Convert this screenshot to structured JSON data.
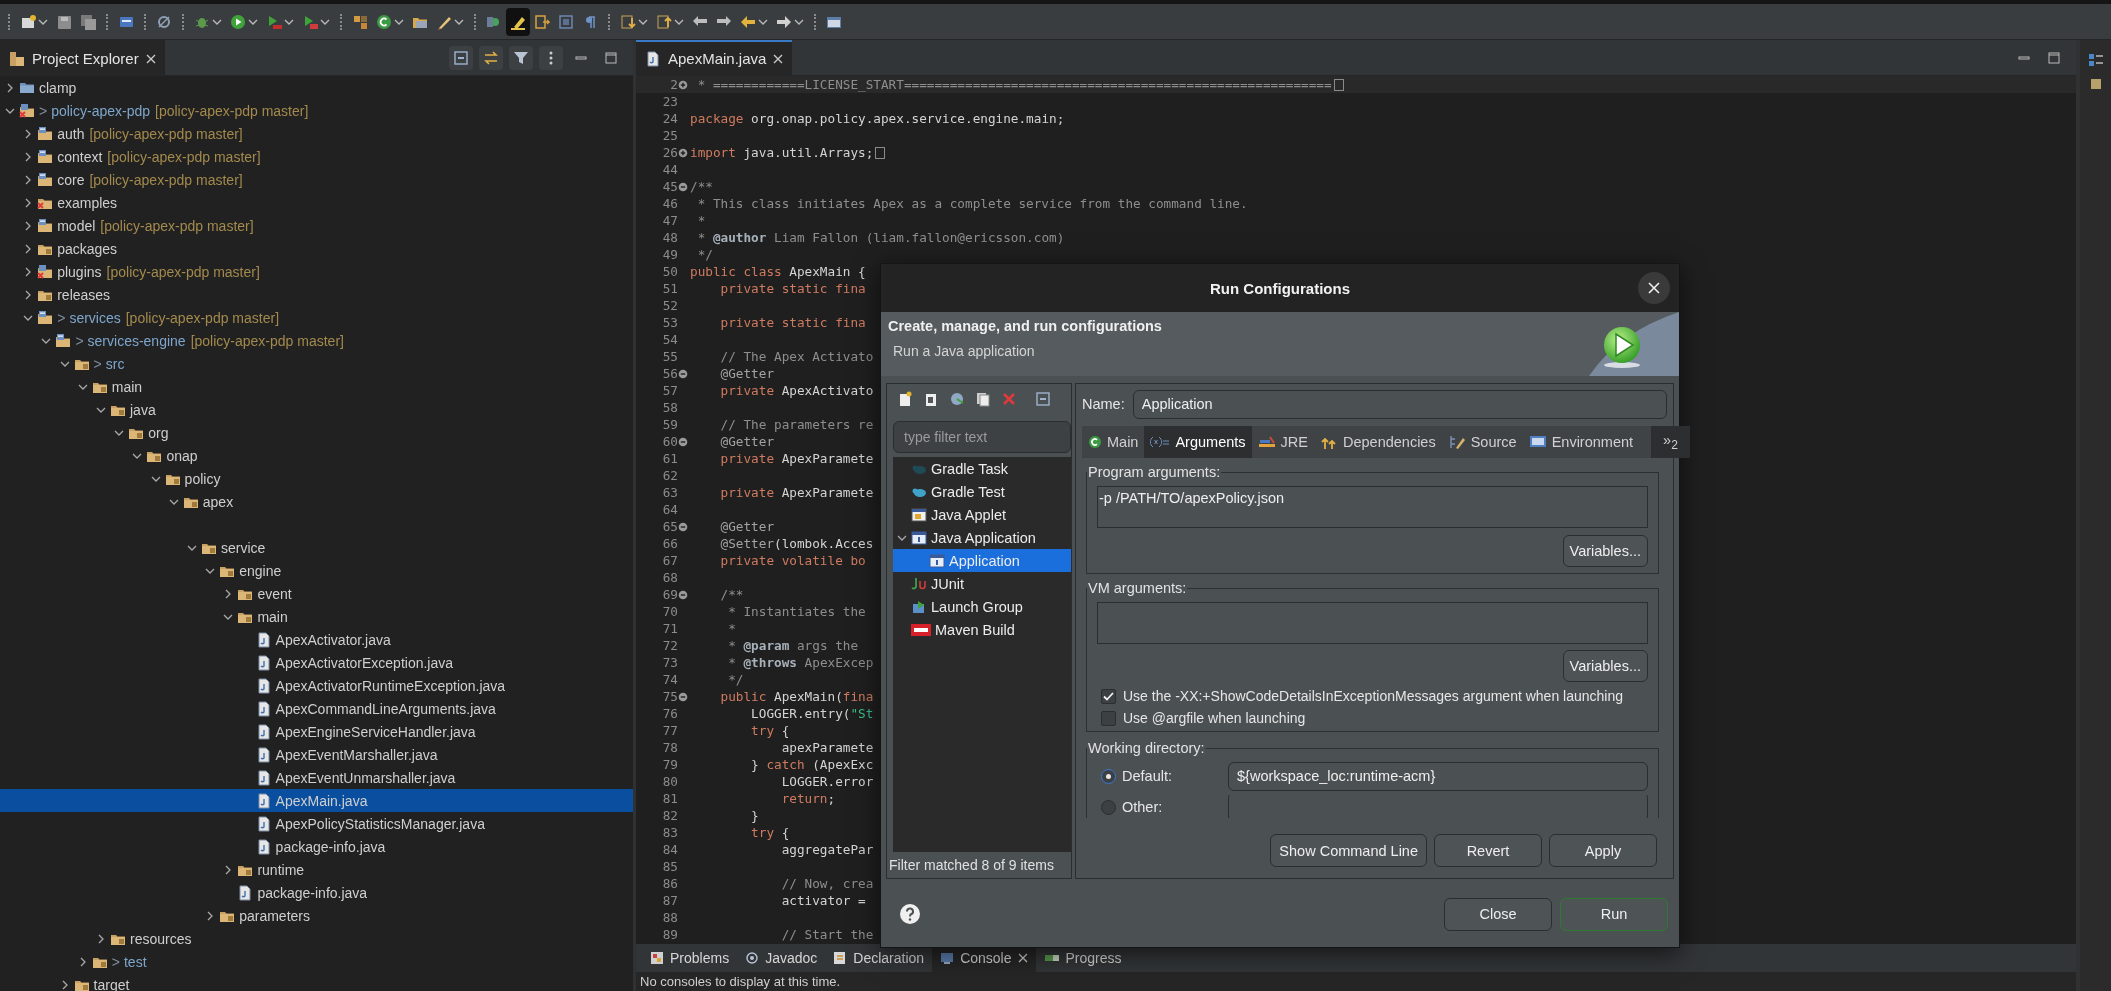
{
  "toolbar": {
    "toggle_on": true
  },
  "explorer": {
    "title": "Project Explorer",
    "tree": [
      {
        "name": "clamp",
        "kind": "closed-project",
        "expanded": false,
        "selected": false
      },
      {
        "marker": ">",
        "name": "policy-apex-pdp",
        "repo": "[policy-apex-pdp master]",
        "kind": "error-project",
        "expanded": true,
        "selected": false,
        "children": [
          {
            "name": "auth",
            "repo": "[policy-apex-pdp master]",
            "kind": "maven-project",
            "expanded": false,
            "selected": false
          },
          {
            "name": "context",
            "repo": "[policy-apex-pdp master]",
            "kind": "maven-project",
            "expanded": false,
            "selected": false
          },
          {
            "name": "core",
            "repo": "[policy-apex-pdp master]",
            "kind": "maven-project",
            "expanded": false,
            "selected": false
          },
          {
            "name": "examples",
            "kind": "error-folder",
            "expanded": false,
            "selected": false
          },
          {
            "name": "model",
            "repo": "[policy-apex-pdp master]",
            "kind": "maven-project",
            "expanded": false,
            "selected": false
          },
          {
            "name": "packages",
            "kind": "package-folder",
            "expanded": false,
            "selected": false
          },
          {
            "name": "plugins",
            "repo": "[policy-apex-pdp master]",
            "kind": "error-project",
            "expanded": false,
            "selected": false
          },
          {
            "name": "releases",
            "kind": "package-folder",
            "expanded": false,
            "selected": false
          },
          {
            "marker": ">",
            "name": "services",
            "repo": "[policy-apex-pdp master]",
            "kind": "maven-project",
            "expanded": true,
            "selected": false,
            "children": [
              {
                "marker": ">",
                "name": "services-engine",
                "repo": "[policy-apex-pdp master]",
                "kind": "maven-project",
                "expanded": true,
                "selected": false,
                "children": [
                  {
                    "marker": ">",
                    "name": "src",
                    "kind": "package-folder",
                    "expanded": true,
                    "selected": false,
                    "children": [
                      {
                        "name": "main",
                        "kind": "package-folder",
                        "expanded": true,
                        "selected": false,
                        "children": [
                          {
                            "name": "java",
                            "kind": "package-folder",
                            "expanded": true,
                            "selected": false,
                            "children": [
                              {
                                "name": "org",
                                "kind": "package-folder",
                                "expanded": true,
                                "selected": false,
                                "children": [
                                  {
                                    "name": "onap",
                                    "kind": "package-folder",
                                    "expanded": true,
                                    "selected": false,
                                    "children": [
                                      {
                                        "name": "policy",
                                        "kind": "package-folder",
                                        "expanded": true,
                                        "selected": false,
                                        "children": [
                                          {
                                            "name": "apex",
                                            "kind": "package-folder",
                                            "expanded": true,
                                            "selected": false,
                                            "children": [
                                              {
                                                "name": "service",
                                                "kind": "package-folder",
                                                "expanded": true,
                                                "selected": false,
                                                "gap_before": true,
                                                "children": [
                                                  {
                                                    "name": "engine",
                                                    "kind": "package-folder",
                                                    "expanded": true,
                                                    "selected": false,
                                                    "children": [
                                                      {
                                                        "name": "event",
                                                        "kind": "package-folder",
                                                        "expanded": false,
                                                        "selected": false
                                                      },
                                                      {
                                                        "name": "main",
                                                        "kind": "package-folder",
                                                        "expanded": true,
                                                        "selected": false,
                                                        "children": [
                                                          {
                                                            "name": "ApexActivator.java",
                                                            "kind": "java-file",
                                                            "selected": false
                                                          },
                                                          {
                                                            "name": "ApexActivatorException.java",
                                                            "kind": "java-file",
                                                            "selected": false
                                                          },
                                                          {
                                                            "name": "ApexActivatorRuntimeException.java",
                                                            "kind": "java-file",
                                                            "selected": false
                                                          },
                                                          {
                                                            "name": "ApexCommandLineArguments.java",
                                                            "kind": "java-file",
                                                            "selected": false
                                                          },
                                                          {
                                                            "name": "ApexEngineServiceHandler.java",
                                                            "kind": "java-file",
                                                            "selected": false
                                                          },
                                                          {
                                                            "name": "ApexEventMarshaller.java",
                                                            "kind": "java-file",
                                                            "selected": false
                                                          },
                                                          {
                                                            "name": "ApexEventUnmarshaller.java",
                                                            "kind": "java-file",
                                                            "selected": false
                                                          },
                                                          {
                                                            "name": "ApexMain.java",
                                                            "kind": "java-file",
                                                            "selected": true
                                                          },
                                                          {
                                                            "name": "ApexPolicyStatisticsManager.java",
                                                            "kind": "java-file",
                                                            "selected": false
                                                          },
                                                          {
                                                            "name": "package-info.java",
                                                            "kind": "java-file",
                                                            "selected": false
                                                          }
                                                        ]
                                                      },
                                                      {
                                                        "name": "runtime",
                                                        "kind": "package-folder",
                                                        "expanded": false,
                                                        "selected": false
                                                      },
                                                      {
                                                        "name": "package-info.java",
                                                        "kind": "java-file",
                                                        "selected": false
                                                      }
                                                    ]
                                                  },
                                                  {
                                                    "name": "parameters",
                                                    "kind": "package-folder",
                                                    "expanded": false,
                                                    "selected": false
                                                  }
                                                ]
                                              }
                                            ]
                                          }
                                        ]
                                      }
                                    ]
                                  }
                                ]
                              }
                            ]
                          },
                          {
                            "name": "resources",
                            "kind": "package-folder",
                            "expanded": false,
                            "selected": false
                          }
                        ]
                      },
                      {
                        "marker": ">",
                        "name": "test",
                        "kind": "package-folder",
                        "expanded": false,
                        "selected": false
                      }
                    ]
                  },
                  {
                    "name": "target",
                    "kind": "package-folder",
                    "expanded": false,
                    "selected": false
                  }
                ]
              }
            ]
          }
        ]
      }
    ]
  },
  "editor": {
    "tab": "ApexMain.java",
    "lines": [
      {
        "n": "2",
        "collapsed": true,
        "current": true,
        "segs": [
          {
            "kind": "comment",
            "text": " * ============LICENSE_START========================================================"
          }
        ]
      },
      {
        "n": "23"
      },
      {
        "n": "24",
        "segs": [
          {
            "kind": "keyword",
            "text": "package"
          },
          {
            "kind": "plain",
            "text": " org.onap.policy.apex.service.engine.main;"
          }
        ]
      },
      {
        "n": "25"
      },
      {
        "n": "26",
        "collapsed": true,
        "segs": [
          {
            "kind": "keyword",
            "text": "import"
          },
          {
            "kind": "plain",
            "text": " java.util.Arrays;"
          }
        ]
      },
      {
        "n": "44"
      },
      {
        "n": "45",
        "collapsed": false,
        "segs": [
          {
            "kind": "comment",
            "text": "/**"
          }
        ]
      },
      {
        "n": "46",
        "segs": [
          {
            "kind": "comment",
            "text": " * This class initiates Apex as a complete service from the command line."
          }
        ]
      },
      {
        "n": "47",
        "segs": [
          {
            "kind": "comment",
            "text": " *"
          }
        ]
      },
      {
        "n": "48",
        "segs": [
          {
            "kind": "comment",
            "text": " * "
          },
          {
            "kind": "doctag",
            "text": "@author"
          },
          {
            "kind": "comment",
            "text": " Liam Fallon (liam.fallon@ericsson.com)"
          }
        ]
      },
      {
        "n": "49",
        "segs": [
          {
            "kind": "comment",
            "text": " */"
          }
        ]
      },
      {
        "n": "50",
        "segs": [
          {
            "kind": "keyword",
            "text": "public class"
          },
          {
            "kind": "plain",
            "text": " ApexMain {"
          }
        ]
      },
      {
        "n": "51",
        "segs": [
          {
            "kind": "keyword",
            "text": "    private static fina"
          }
        ]
      },
      {
        "n": "52"
      },
      {
        "n": "53",
        "segs": [
          {
            "kind": "keyword",
            "text": "    private static fina"
          }
        ]
      },
      {
        "n": "54"
      },
      {
        "n": "55",
        "segs": [
          {
            "kind": "comment",
            "text": "    // The Apex Activato"
          }
        ]
      },
      {
        "n": "56",
        "collapsed": false,
        "segs": [
          {
            "kind": "annotation",
            "text": "    @Getter"
          }
        ]
      },
      {
        "n": "57",
        "segs": [
          {
            "kind": "keyword",
            "text": "    private"
          },
          {
            "kind": "plain",
            "text": " ApexActivato"
          }
        ]
      },
      {
        "n": "58"
      },
      {
        "n": "59",
        "segs": [
          {
            "kind": "comment",
            "text": "    // The parameters re"
          }
        ]
      },
      {
        "n": "60",
        "collapsed": false,
        "segs": [
          {
            "kind": "annotation",
            "text": "    @Getter"
          }
        ]
      },
      {
        "n": "61",
        "segs": [
          {
            "kind": "keyword",
            "text": "    private"
          },
          {
            "kind": "plain",
            "text": " ApexParamete"
          }
        ]
      },
      {
        "n": "62"
      },
      {
        "n": "63",
        "segs": [
          {
            "kind": "keyword",
            "text": "    private"
          },
          {
            "kind": "plain",
            "text": " ApexParamete"
          }
        ]
      },
      {
        "n": "64"
      },
      {
        "n": "65",
        "collapsed": false,
        "segs": [
          {
            "kind": "annotation",
            "text": "    @Getter"
          }
        ]
      },
      {
        "n": "66",
        "segs": [
          {
            "kind": "annotation",
            "text": "    @Setter"
          },
          {
            "kind": "plain",
            "text": "(lombok.Acces"
          }
        ]
      },
      {
        "n": "67",
        "segs": [
          {
            "kind": "keyword",
            "text": "    private volatile bo"
          }
        ]
      },
      {
        "n": "68"
      },
      {
        "n": "69",
        "collapsed": false,
        "segs": [
          {
            "kind": "comment",
            "text": "    /**"
          }
        ]
      },
      {
        "n": "70",
        "segs": [
          {
            "kind": "comment",
            "text": "     * Instantiates the"
          }
        ]
      },
      {
        "n": "71",
        "segs": [
          {
            "kind": "comment",
            "text": "     *"
          }
        ]
      },
      {
        "n": "72",
        "segs": [
          {
            "kind": "comment",
            "text": "     * "
          },
          {
            "kind": "doctag",
            "text": "@param"
          },
          {
            "kind": "comment",
            "text": " args the"
          }
        ]
      },
      {
        "n": "73",
        "segs": [
          {
            "kind": "comment",
            "text": "     * "
          },
          {
            "kind": "doctag",
            "text": "@throws"
          },
          {
            "kind": "comment",
            "text": " ApexExcep"
          }
        ]
      },
      {
        "n": "74",
        "segs": [
          {
            "kind": "comment",
            "text": "     */"
          }
        ]
      },
      {
        "n": "75",
        "collapsed": false,
        "segs": [
          {
            "kind": "keyword",
            "text": "    public"
          },
          {
            "kind": "plain",
            "text": " ApexMain("
          },
          {
            "kind": "keyword",
            "text": "fina"
          }
        ]
      },
      {
        "n": "76",
        "segs": [
          {
            "kind": "plain",
            "text": "        LOGGER.entry("
          },
          {
            "kind": "string",
            "text": "\"St"
          }
        ]
      },
      {
        "n": "77",
        "segs": [
          {
            "kind": "keyword",
            "text": "        try"
          },
          {
            "kind": "plain",
            "text": " {"
          }
        ]
      },
      {
        "n": "78",
        "segs": [
          {
            "kind": "plain",
            "text": "            apexParamete"
          }
        ]
      },
      {
        "n": "79",
        "segs": [
          {
            "kind": "plain",
            "text": "        } "
          },
          {
            "kind": "keyword",
            "text": "catch"
          },
          {
            "kind": "plain",
            "text": " (ApexExc"
          }
        ]
      },
      {
        "n": "80",
        "segs": [
          {
            "kind": "plain",
            "text": "            LOGGER.error"
          }
        ]
      },
      {
        "n": "81",
        "segs": [
          {
            "kind": "keyword",
            "text": "            return"
          },
          {
            "kind": "plain",
            "text": ";"
          }
        ]
      },
      {
        "n": "82",
        "segs": [
          {
            "kind": "plain",
            "text": "        }"
          }
        ]
      },
      {
        "n": "83",
        "segs": [
          {
            "kind": "keyword",
            "text": "        try"
          },
          {
            "kind": "plain",
            "text": " {"
          }
        ]
      },
      {
        "n": "84",
        "segs": [
          {
            "kind": "plain",
            "text": "            aggregatePar"
          }
        ]
      },
      {
        "n": "85"
      },
      {
        "n": "86",
        "segs": [
          {
            "kind": "comment",
            "text": "            // Now, crea"
          }
        ]
      },
      {
        "n": "87",
        "segs": [
          {
            "kind": "plain",
            "text": "            activator ="
          }
        ]
      },
      {
        "n": "88"
      },
      {
        "n": "89",
        "segs": [
          {
            "kind": "comment",
            "text": "            // Start the"
          }
        ]
      }
    ]
  },
  "bottom_panel": {
    "tabs": [
      {
        "label": "Problems",
        "kind": "problems",
        "selected": false
      },
      {
        "label": "Javadoc",
        "kind": "javadoc",
        "selected": false
      },
      {
        "label": "Declaration",
        "kind": "declaration",
        "selected": false
      },
      {
        "label": "Console",
        "kind": "console",
        "selected": true
      },
      {
        "label": "Progress",
        "kind": "progress",
        "selected": false
      }
    ],
    "message": "No consoles to display at this time."
  },
  "dialog": {
    "title": "Run Configurations",
    "heading": "Create, manage, and run configurations",
    "subheading": "Run a Java application",
    "filter": {
      "placeholder": "type filter text"
    },
    "config_tree": [
      {
        "label": "Gradle Task",
        "kind": "gradle-task",
        "selected": false
      },
      {
        "label": "Gradle Test",
        "kind": "gradle-test",
        "selected": false
      },
      {
        "label": "Java Applet",
        "kind": "applet",
        "selected": false
      },
      {
        "label": "Java Application",
        "kind": "java-app",
        "expanded": true,
        "selected": false,
        "children": [
          {
            "label": "Application",
            "kind": "java-app",
            "selected": true
          }
        ]
      },
      {
        "label": "JUnit",
        "kind": "junit",
        "selected": false
      },
      {
        "label": "Launch Group",
        "kind": "launch-group",
        "selected": false
      },
      {
        "label": "Maven Build",
        "kind": "maven",
        "selected": false
      }
    ],
    "filter_status": "Filter matched 8 of 9 items",
    "name_label": "Name:",
    "name_value": "Application",
    "tabs": [
      {
        "label": "Main",
        "kind": "main",
        "selected": false
      },
      {
        "label": "Arguments",
        "kind": "arguments",
        "selected": true
      },
      {
        "label": "JRE",
        "kind": "jre",
        "selected": false
      },
      {
        "label": "Dependencies",
        "kind": "dependencies",
        "selected": false
      },
      {
        "label": "Source",
        "kind": "source",
        "selected": false
      },
      {
        "label": "Environment",
        "kind": "environment",
        "selected": false
      },
      {
        "label": "»$_{2}$",
        "kind": "overflow",
        "selected": false
      }
    ],
    "program_args": {
      "label": "Program arguments:",
      "value": "-p /PATH/TO/apexPolicy.json",
      "button": "Variables..."
    },
    "vm_args": {
      "label": "VM arguments:",
      "button": "Variables..."
    },
    "options": [
      {
        "label": "Use the -XX:+ShowCodeDetailsInExceptionMessages argument when launching",
        "checked": true
      },
      {
        "label": "Use @argfile when launching",
        "checked": false
      }
    ],
    "working_dir": {
      "label": "Working directory:",
      "options": [
        {
          "label": "Default:",
          "selected": true,
          "value": "${workspace_loc:runtime-acm}"
        },
        {
          "label": "Other:",
          "selected": false
        }
      ]
    },
    "actions": [
      "Show Command Line",
      "Revert",
      "Apply"
    ],
    "footer_buttons": [
      {
        "label": "Close",
        "default": false
      },
      {
        "label": "Run",
        "default": true
      }
    ]
  }
}
